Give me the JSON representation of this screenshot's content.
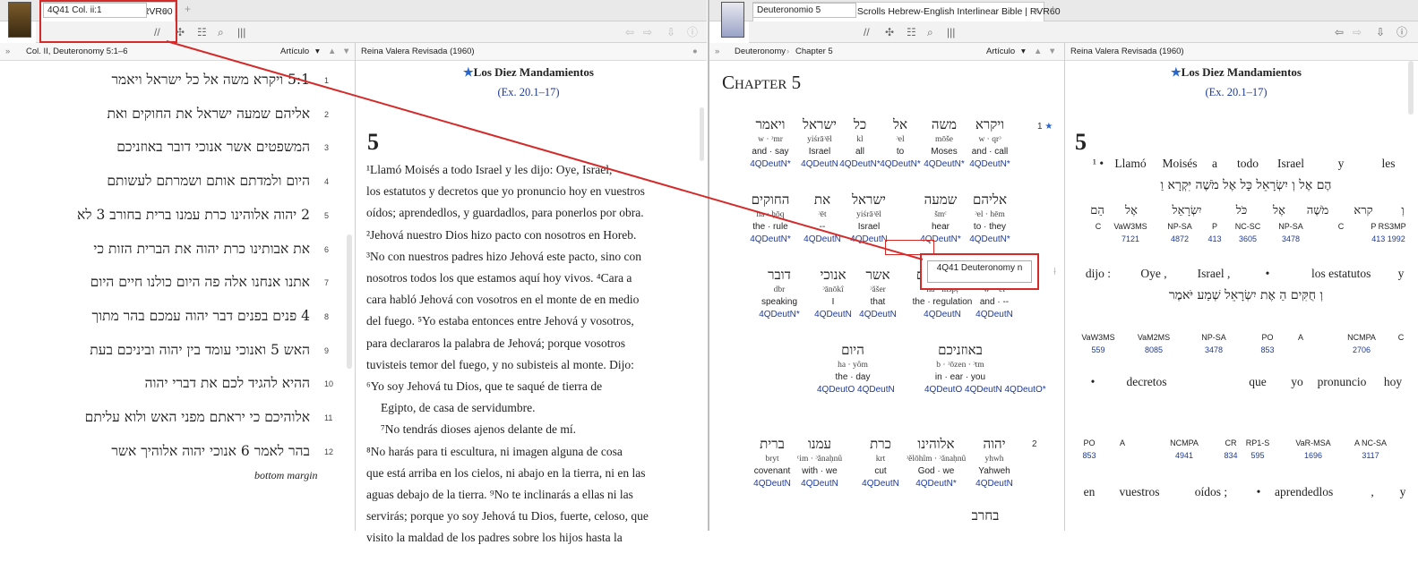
{
  "left": {
    "tab_title": "4Q41 Deuteronomy n | RVR60",
    "ref_input": "4Q41 Col. ii:1",
    "pane1_header": "Col. II, Deuteronomy 5:1–6",
    "pane1_mode": "Artículo",
    "pane2_header": "Reina Valera Revisada (1960)",
    "hebrew_lines": [
      {
        "num": "1",
        "text": "5:1 ויקרא משה אל כל ישראל ויאמר"
      },
      {
        "num": "2",
        "text": "אליהם שמעה ישראל את החוקים ואת"
      },
      {
        "num": "3",
        "text": "המשפטים אשר אנוכי דובר באוזניכם"
      },
      {
        "num": "4",
        "text": "היום ולמדתם אותם ושמרתם לעשותם"
      },
      {
        "num": "5",
        "text": "2 יהוה אלוהינו כרת עמנו ברית בחורב 3 לא"
      },
      {
        "num": "6",
        "text": "את אבותינו כרת יהוה את הברית הזות כי"
      },
      {
        "num": "7",
        "text": "אתנו אנחנו אלה פה היום כולנו חיים היום"
      },
      {
        "num": "8",
        "text": "4 פנים בפנים דבר יהוה עמכם בהר מתוך"
      },
      {
        "num": "9",
        "text": "האש 5 ואנוכי עומד בין יהוה וביניכם בעת"
      },
      {
        "num": "10",
        "text": "ההיא להגיד לכם את דברי יהוה"
      },
      {
        "num": "11",
        "text": "אלוהיכם כי יראתם מפני האש ולוא עליתם"
      },
      {
        "num": "12",
        "text": "בהר לאמר 6 אנוכי יהוה אלוהיך אשר"
      }
    ],
    "bottom_margin": "bottom margin",
    "rvr": {
      "section_title": "Los Diez Mandamientos",
      "section_ref": "(Ex. 20.1–17)",
      "chapter": "5",
      "lines": [
        "¹Llamó Moisés a todo Israel y les dijo: Oye, Israel,",
        "los estatutos y decretos que yo pronuncio hoy en vuestros",
        "oídos; aprendedlos, y guardadlos, para ponerlos por obra.",
        "²Jehová nuestro Dios hizo pacto con nosotros en Horeb.",
        "³No con nuestros padres hizo Jehová este pacto, sino con",
        "nosotros todos los que estamos aquí hoy vivos. ⁴Cara a",
        "cara habló Jehová con vosotros en el monte de en medio",
        "del fuego. ⁵Yo estaba entonces entre Jehová y vosotros,",
        "para declararos la palabra de Jehová; porque vosotros",
        "tuvisteis temor del fuego, y no subisteis al monte. Dijo:",
        "⁶Yo soy Jehová tu Dios, que te saqué de tierra de",
        "Egipto, de casa de servidumbre.",
        "⁷No tendrás dioses ajenos delante de mí.",
        "⁸No harás para ti escultura, ni imagen alguna de cosa",
        "que está arriba en los cielos, ni abajo en la tierra, ni en las",
        "aguas debajo de la tierra. ⁹No te inclinarás a ellas ni las",
        "servirás; porque yo soy Jehová tu Dios, fuerte, celoso, que",
        "visito la maldad de los padres sobre los hijos hasta la"
      ]
    }
  },
  "right": {
    "tab_title": "The Lexham Dead Sea Scrolls Hebrew-English Interlinear Bible | RVR60",
    "ref_input": "Deuteronomio 5",
    "breadcrumb_book": "Deuteronomy",
    "breadcrumb_chapter": "Chapter 5",
    "pane3_mode": "Artículo",
    "pane4_header": "Reina Valera Revisada (1960)",
    "chapter_heading": "Chapter 5",
    "interlinear": [
      {
        "heb": "ויקרא",
        "tr": "w · qrᵓ",
        "gl": "and · call",
        "src": "4QDeutN*"
      },
      {
        "heb": "משה",
        "tr": "mōše",
        "gl": "Moses",
        "src": "4QDeutN*"
      },
      {
        "heb": "אל",
        "tr": "ᵓel",
        "gl": "to",
        "src": "4QDeutN*"
      },
      {
        "heb": "כל",
        "tr": "kl",
        "gl": "all",
        "src": "4QDeutN*"
      },
      {
        "heb": "ישראל",
        "tr": "yiśrāᵓēl",
        "gl": "Israel",
        "src": "4QDeutN"
      },
      {
        "heb": "ויאמר",
        "tr": "w · ᵓmr",
        "gl": "and · say",
        "src": "4QDeutN*"
      },
      {
        "heb": "אליהם",
        "tr": "ᵓel · hēm",
        "gl": "to · they",
        "src": "4QDeutN*"
      },
      {
        "heb": "שמעה",
        "tr": "šmᶜ",
        "gl": "hear",
        "src": "4QDeutN*"
      },
      {
        "heb": "ישראל",
        "tr": "yiśrāᵓēl",
        "gl": "Israel",
        "src": "4QDeutN"
      },
      {
        "heb": "את",
        "tr": "ᵓēt",
        "gl": "--",
        "src": "4QDeutN"
      },
      {
        "heb": "החוקים",
        "tr": "ha · ḥōq",
        "gl": "the · rule",
        "src": "4QDeutN*"
      },
      {
        "heb": "ואת",
        "tr": "w · ᵓēt",
        "gl": "and · --",
        "src": "4QDeutN"
      },
      {
        "heb": "המשפטים",
        "tr": "ha · mšpṭ",
        "gl": "the · regulation",
        "src": "4QDeutN"
      },
      {
        "heb": "אשר",
        "tr": "ᵓăšer",
        "gl": "that",
        "src": "4QDeutN"
      },
      {
        "heb": "אנוכי",
        "tr": "ᵓānōkî",
        "gl": "I",
        "src": "4QDeutN"
      },
      {
        "heb": "דובר",
        "tr": "dbr",
        "gl": "speaking",
        "src": "4QDeutN*"
      },
      {
        "heb": "באוזניכם",
        "tr": "b · ᵓōzen · ᵓtm",
        "gl": "in · ear · you",
        "src": "4QDeutO 4QDeutN 4QDeutO*"
      },
      {
        "heb": "היום",
        "tr": "ha · yôm",
        "gl": "the · day",
        "src": "4QDeutO 4QDeutN"
      },
      {
        "heb": "יהוה",
        "tr": "yhwh",
        "gl": "Yahweh",
        "src": "4QDeutN"
      },
      {
        "heb": "אלוהינו",
        "tr": "ᵓĕlōhîm · ᵓănaḥnû",
        "gl": "God · we",
        "src": "4QDeutN*"
      },
      {
        "heb": "כרת",
        "tr": "krt",
        "gl": "cut",
        "src": "4QDeutN"
      },
      {
        "heb": "עמנו",
        "tr": "ᶜim · ᵓănaḥnû",
        "gl": "with · we",
        "src": "4QDeutN"
      },
      {
        "heb": "ברית",
        "tr": "bryt",
        "gl": "covenant",
        "src": "4QDeutN"
      },
      {
        "heb": "בחרב",
        "tr": "",
        "gl": "",
        "src": ""
      }
    ],
    "verse_nums": [
      "1",
      "2"
    ],
    "tooltip": "4Q41 Deuteronomy n",
    "rvr_rev": {
      "section_title": "Los Diez Mandamientos",
      "section_ref": "(Ex. 20.1–17)",
      "chapter": "5",
      "row1_spanish": [
        "¹ •",
        "Llamó",
        "Moisés",
        "a",
        "todo",
        "Israel",
        "y",
        "les"
      ],
      "row1_hebrew": "הֶם אֶל וְ יִשְׂרָאֵל כָּל אֶל מֹשֶׁה יִּקְרָא וַ",
      "row1_lemma": [
        "וְ",
        "קרא",
        "מֹשֶׁה",
        "אֶל",
        "כֹּל",
        "יִשְׂרָאֵל",
        "אֶל",
        "הֵם"
      ],
      "row1_morph": [
        "C",
        "VaW3MS",
        "NP-SA",
        "P",
        "NC-SC",
        "NP-SA",
        "C",
        "P RS3MP"
      ],
      "row1_strong": [
        "",
        "7121",
        "4872",
        "413",
        "3605",
        "3478",
        "",
        "413 1992"
      ],
      "row2_spanish": [
        "dijo :",
        "Oye ,",
        "Israel ,",
        "•",
        "los estatutos",
        "y"
      ],
      "row2_hebrew": "וְ חֻקִּים הַ אֶת יִשְׂרָאֵל שְׁמַע יֹּאמֶר",
      "row2_morph": [
        "VaW3MS",
        "VaM2MS",
        "NP-SA",
        "PO",
        "A",
        "NCMPA",
        "C"
      ],
      "row2_strong": [
        "559",
        "8085",
        "3478",
        "853",
        "",
        "2706",
        ""
      ],
      "row3_spanish": [
        "•",
        "decretos",
        "que",
        "yo",
        "pronuncio",
        "hoy"
      ],
      "row3_morph": [
        "PO",
        "A",
        "NCMPA",
        "CR",
        "RP1-S",
        "VaR-MSA",
        "A NC-SA"
      ],
      "row3_strong": [
        "853",
        "",
        "4941",
        "834",
        "595",
        "1696",
        "3117"
      ],
      "row4_spanish": [
        "en",
        "vuestros",
        "oídos ;",
        "•",
        "aprendedlos",
        ",",
        "y"
      ]
    }
  }
}
